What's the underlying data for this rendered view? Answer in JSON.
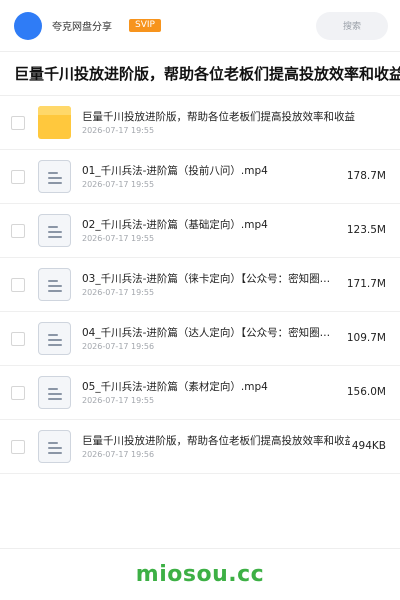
{
  "header": {
    "brand": "夸克网盘分享",
    "badge": "SVIP",
    "search_placeholder": "搜索"
  },
  "page_title": "巨量千川投放进阶版，帮助各位老板们提高投放效率和收益",
  "files": [
    {
      "type": "folder",
      "name": "巨量千川投放进阶版，帮助各位老板们提高投放效率和收益",
      "date": "2026-07-17 19:55",
      "size": ""
    },
    {
      "type": "file",
      "name": "01_千川兵法-进阶篇（投前八问）.mp4",
      "date": "2026-07-17 19:55",
      "size": "178.7M"
    },
    {
      "type": "file",
      "name": "02_千川兵法-进阶篇（基础定向）.mp4",
      "date": "2026-07-17 19:55",
      "size": "123.5M"
    },
    {
      "type": "file",
      "name": "03_千川兵法-进阶篇（徕卡定向）【公众号：密知圈…",
      "date": "2026-07-17 19:55",
      "size": "171.7M"
    },
    {
      "type": "file",
      "name": "04_千川兵法-进阶篇（达人定向）【公众号：密知圈…",
      "date": "2026-07-17 19:56",
      "size": "109.7M"
    },
    {
      "type": "file",
      "name": "05_千川兵法-进阶篇（素材定向）.mp4",
      "date": "2026-07-17 19:55",
      "size": "156.0M"
    },
    {
      "type": "file",
      "name": "巨量千川投放进阶版，帮助各位老板们提高投放效率和收益.txt",
      "date": "2026-07-17 19:56",
      "size": "494KB"
    }
  ],
  "watermark": "miosou.cc",
  "colors": {
    "avatar": "#2f7cf6",
    "badge": "#f7941d",
    "folder": "#ffc83d",
    "watermark": "#3db045"
  },
  "icons": {
    "folder": "folder-icon",
    "file": "document-icon"
  }
}
